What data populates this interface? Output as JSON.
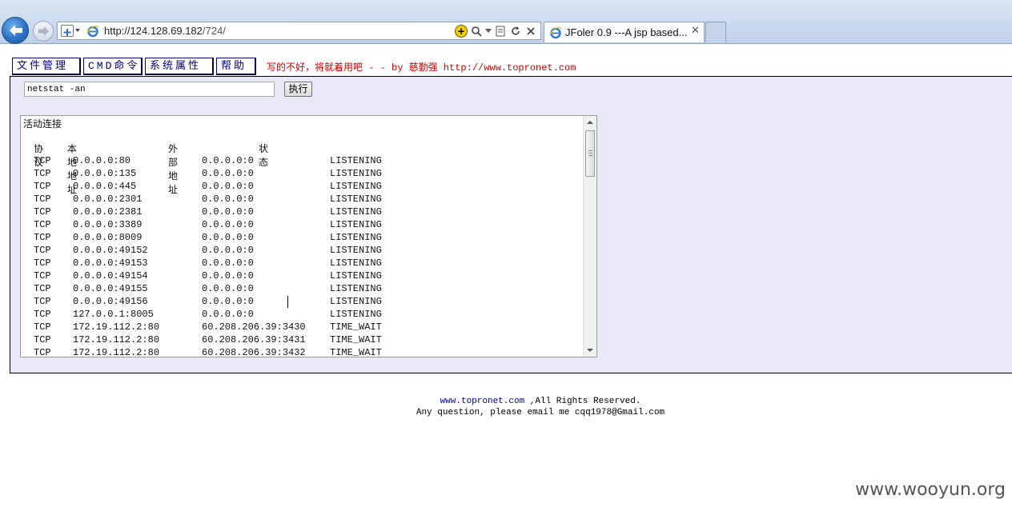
{
  "browser": {
    "url_host": "http://124.128.69.182",
    "url_path": "/724/",
    "tab_title": "JFoler 0.9 ---A jsp based...",
    "tab_close": "✕"
  },
  "menu": {
    "file_manage": "文件管理",
    "cmd": "CMD命令",
    "sys_props": "系统属性",
    "help": "帮助",
    "notice": "写的不好，将就着用吧 - - by 慈勤强 http://www.topronet.com"
  },
  "cmd": {
    "input_value": "netstat -an",
    "exec_label": "执行"
  },
  "output": {
    "title": "活动连接",
    "headers": {
      "proto": "协议",
      "local": "本地地址",
      "foreign": "外部地址",
      "state": "状态"
    },
    "rows": [
      {
        "proto": "TCP",
        "local": "0.0.0.0:80",
        "foreign": "0.0.0.0:0",
        "state": "LISTENING"
      },
      {
        "proto": "TCP",
        "local": "0.0.0.0:135",
        "foreign": "0.0.0.0:0",
        "state": "LISTENING"
      },
      {
        "proto": "TCP",
        "local": "0.0.0.0:445",
        "foreign": "0.0.0.0:0",
        "state": "LISTENING"
      },
      {
        "proto": "TCP",
        "local": "0.0.0.0:2301",
        "foreign": "0.0.0.0:0",
        "state": "LISTENING"
      },
      {
        "proto": "TCP",
        "local": "0.0.0.0:2381",
        "foreign": "0.0.0.0:0",
        "state": "LISTENING"
      },
      {
        "proto": "TCP",
        "local": "0.0.0.0:3389",
        "foreign": "0.0.0.0:0",
        "state": "LISTENING"
      },
      {
        "proto": "TCP",
        "local": "0.0.0.0:8009",
        "foreign": "0.0.0.0:0",
        "state": "LISTENING"
      },
      {
        "proto": "TCP",
        "local": "0.0.0.0:49152",
        "foreign": "0.0.0.0:0",
        "state": "LISTENING"
      },
      {
        "proto": "TCP",
        "local": "0.0.0.0:49153",
        "foreign": "0.0.0.0:0",
        "state": "LISTENING"
      },
      {
        "proto": "TCP",
        "local": "0.0.0.0:49154",
        "foreign": "0.0.0.0:0",
        "state": "LISTENING"
      },
      {
        "proto": "TCP",
        "local": "0.0.0.0:49155",
        "foreign": "0.0.0.0:0",
        "state": "LISTENING"
      },
      {
        "proto": "TCP",
        "local": "0.0.0.0:49156",
        "foreign": "0.0.0.0:0",
        "state": "LISTENING"
      },
      {
        "proto": "TCP",
        "local": "127.0.0.1:8005",
        "foreign": "0.0.0.0:0",
        "state": "LISTENING"
      },
      {
        "proto": "TCP",
        "local": "172.19.112.2:80",
        "foreign": "60.208.206.39:3430",
        "state": "TIME_WAIT"
      },
      {
        "proto": "TCP",
        "local": "172.19.112.2:80",
        "foreign": "60.208.206.39:3431",
        "state": "TIME_WAIT"
      },
      {
        "proto": "TCP",
        "local": "172.19.112.2:80",
        "foreign": "60.208.206.39:3432",
        "state": "TIME_WAIT"
      }
    ]
  },
  "footer": {
    "link": "www.topronet.com",
    "rights": " ,All Rights Reserved.",
    "contact": "Any question, please email me cqq1978@Gmail.com"
  },
  "watermark": "www.wooyun.org",
  "icons": {
    "back": "back-arrow-icon",
    "forward": "forward-arrow-icon",
    "favorite": "add-favorite-icon",
    "ie": "ie-logo-icon",
    "compat": "compatibility-icon",
    "search": "search-icon",
    "refresh": "refresh-icon",
    "stop": "stop-icon"
  }
}
